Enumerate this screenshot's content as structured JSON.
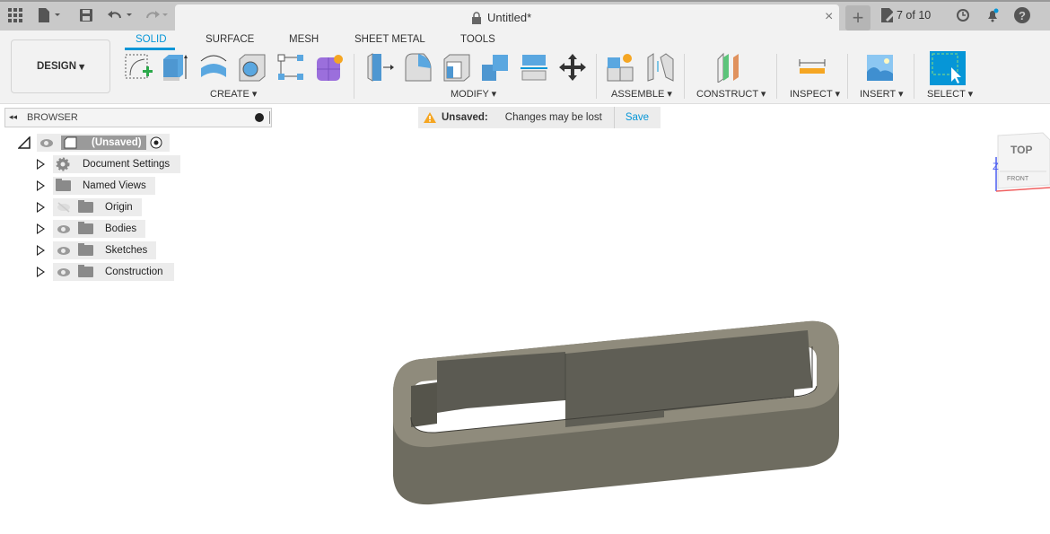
{
  "titlebar": {
    "document_title": "Untitled*",
    "version_label": "7 of 10"
  },
  "toolbar": {
    "workspace": "DESIGN",
    "tabs": [
      {
        "label": "SOLID",
        "active": true
      },
      {
        "label": "SURFACE"
      },
      {
        "label": "MESH"
      },
      {
        "label": "SHEET METAL"
      },
      {
        "label": "TOOLS"
      }
    ],
    "groups": {
      "create": "CREATE",
      "modify": "MODIFY",
      "assemble": "ASSEMBLE",
      "construct": "CONSTRUCT",
      "inspect": "INSPECT",
      "insert": "INSERT",
      "select": "SELECT"
    },
    "accent": "#0696d7"
  },
  "browser": {
    "title": "BROWSER",
    "root": "(Unsaved)",
    "items": [
      {
        "label": "Document Settings",
        "icon": "gear-icon"
      },
      {
        "label": "Named Views",
        "icon": "folder-icon"
      },
      {
        "label": "Origin",
        "icon": "folder-icon",
        "hidden": true
      },
      {
        "label": "Bodies",
        "icon": "folder-icon"
      },
      {
        "label": "Sketches",
        "icon": "folder-icon"
      },
      {
        "label": "Construction",
        "icon": "folder-icon"
      }
    ]
  },
  "unsaved_banner": {
    "label": "Unsaved:",
    "message": "Changes may be lost",
    "action": "Save"
  },
  "viewcube": {
    "top": "TOP",
    "front": "FRONT",
    "axis": "Z"
  }
}
